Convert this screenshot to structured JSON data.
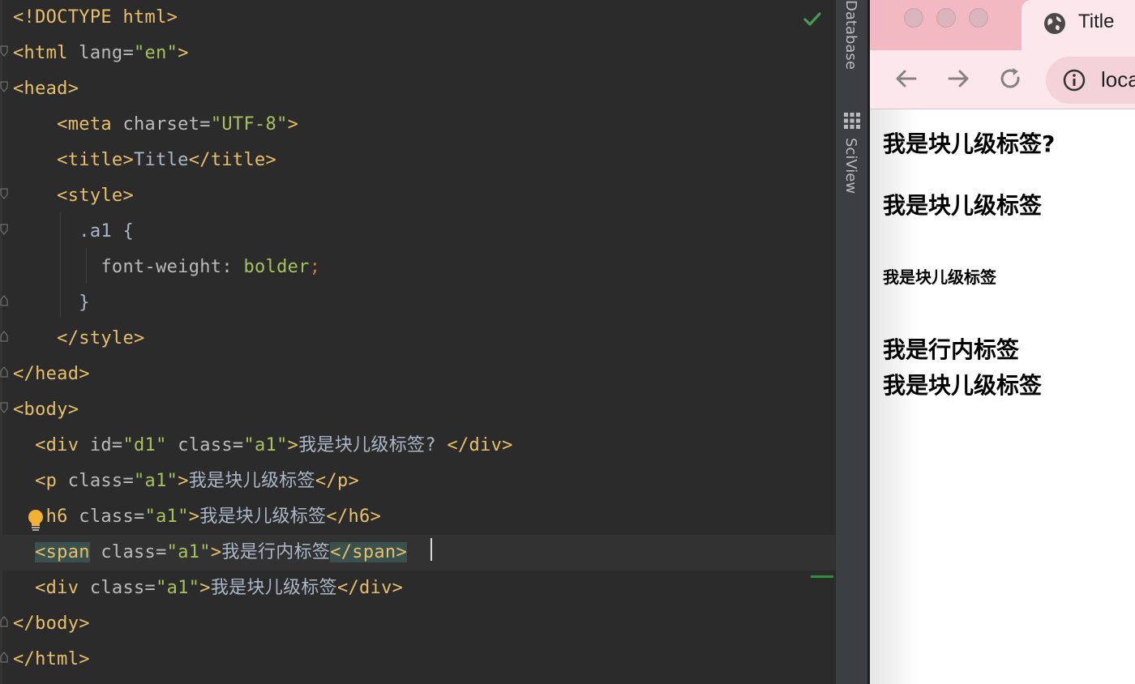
{
  "editor": {
    "lines": [
      {
        "tokens": [
          {
            "c": "tk-tag",
            "t": "<!DOCTYPE html>"
          }
        ]
      },
      {
        "tokens": [
          {
            "c": "tk-tag",
            "t": "<html "
          },
          {
            "c": "tk-attr",
            "t": "lang="
          },
          {
            "c": "tk-str",
            "t": "\"en\""
          },
          {
            "c": "tk-tag",
            "t": ">"
          }
        ]
      },
      {
        "tokens": [
          {
            "c": "tk-tag",
            "t": "<head>"
          }
        ]
      },
      {
        "tokens": [
          {
            "c": "tk-tag",
            "t": "    <meta "
          },
          {
            "c": "tk-attr",
            "t": "charset="
          },
          {
            "c": "tk-str",
            "t": "\"UTF-8\""
          },
          {
            "c": "tk-tag",
            "t": ">"
          }
        ]
      },
      {
        "tokens": [
          {
            "c": "tk-tag",
            "t": "    <title>"
          },
          {
            "c": "tk-text",
            "t": "Title"
          },
          {
            "c": "tk-tag",
            "t": "</title>"
          }
        ]
      },
      {
        "tokens": [
          {
            "c": "tk-tag",
            "t": "    <style>"
          }
        ]
      },
      {
        "tokens": [
          {
            "c": "tk-text",
            "t": "      .a1 {"
          }
        ]
      },
      {
        "tokens": [
          {
            "c": "tk-attr",
            "t": "        font-weight: "
          },
          {
            "c": "tk-val",
            "t": "bolder"
          },
          {
            "c": "tk-kw",
            "t": ";"
          }
        ]
      },
      {
        "tokens": [
          {
            "c": "tk-text",
            "t": "      }"
          }
        ]
      },
      {
        "tokens": [
          {
            "c": "tk-tag",
            "t": "    </style>"
          }
        ]
      },
      {
        "tokens": [
          {
            "c": "tk-tag",
            "t": "</head>"
          }
        ]
      },
      {
        "tokens": [
          {
            "c": "tk-tag",
            "t": "<body>"
          }
        ]
      },
      {
        "tokens": [
          {
            "c": "tk-tag",
            "t": "  <div "
          },
          {
            "c": "tk-attr",
            "t": "id="
          },
          {
            "c": "tk-str",
            "t": "\"d1\""
          },
          {
            "c": "tk-attr",
            "t": " class="
          },
          {
            "c": "tk-str",
            "t": "\"a1\""
          },
          {
            "c": "tk-tag",
            "t": ">"
          },
          {
            "c": "tk-text",
            "t": "我是块儿级标签? "
          },
          {
            "c": "tk-tag",
            "t": "</div>"
          }
        ]
      },
      {
        "tokens": [
          {
            "c": "tk-tag",
            "t": "  <p "
          },
          {
            "c": "tk-attr",
            "t": "class="
          },
          {
            "c": "tk-str",
            "t": "\"a1\""
          },
          {
            "c": "tk-tag",
            "t": ">"
          },
          {
            "c": "tk-text",
            "t": "我是块儿级标签"
          },
          {
            "c": "tk-tag",
            "t": "</p>"
          }
        ]
      },
      {
        "tokens": [
          {
            "c": "tk-tag",
            "t": "   h6 "
          },
          {
            "c": "tk-attr",
            "t": "class="
          },
          {
            "c": "tk-str",
            "t": "\"a1\""
          },
          {
            "c": "tk-tag",
            "t": ">"
          },
          {
            "c": "tk-text",
            "t": "我是块儿级标签"
          },
          {
            "c": "tk-tag",
            "t": "</h6>"
          }
        ]
      },
      {
        "current": true,
        "tokens": [
          {
            "c": "tk-text",
            "t": "  "
          },
          {
            "c": "tk-tag tk-match",
            "t": "<span"
          },
          {
            "c": "tk-attr",
            "t": " class="
          },
          {
            "c": "tk-str",
            "t": "\"a1\""
          },
          {
            "c": "tk-tag",
            "t": ">"
          },
          {
            "c": "tk-text",
            "t": "我是行内标签"
          },
          {
            "c": "tk-tag tk-match",
            "t": "</span>"
          }
        ]
      },
      {
        "tokens": [
          {
            "c": "tk-tag",
            "t": "  <div "
          },
          {
            "c": "tk-attr",
            "t": "class="
          },
          {
            "c": "tk-str",
            "t": "\"a1\""
          },
          {
            "c": "tk-tag",
            "t": ">"
          },
          {
            "c": "tk-text",
            "t": "我是块儿级标签"
          },
          {
            "c": "tk-tag",
            "t": "</div>"
          }
        ]
      },
      {
        "tokens": [
          {
            "c": "tk-tag",
            "t": "</body>"
          }
        ]
      },
      {
        "tokens": [
          {
            "c": "tk-tag",
            "t": "</html>"
          }
        ]
      }
    ]
  },
  "toolwindows": {
    "database_label": "Database",
    "sciview_label": "SciView"
  },
  "browser": {
    "tab_title": "Title",
    "address_text": "localhost",
    "page": {
      "div1": "我是块儿级标签?",
      "p": "我是块儿级标签",
      "h6": "我是块儿级标签",
      "span": "我是行内标签",
      "div2": "我是块儿级标签"
    }
  },
  "colors": {
    "editor_bg": "#2b2b2b",
    "tag": "#e8bf6a",
    "string": "#a5c25c",
    "text": "#a9b7c6",
    "browser_chrome": "#f2b9c3"
  }
}
